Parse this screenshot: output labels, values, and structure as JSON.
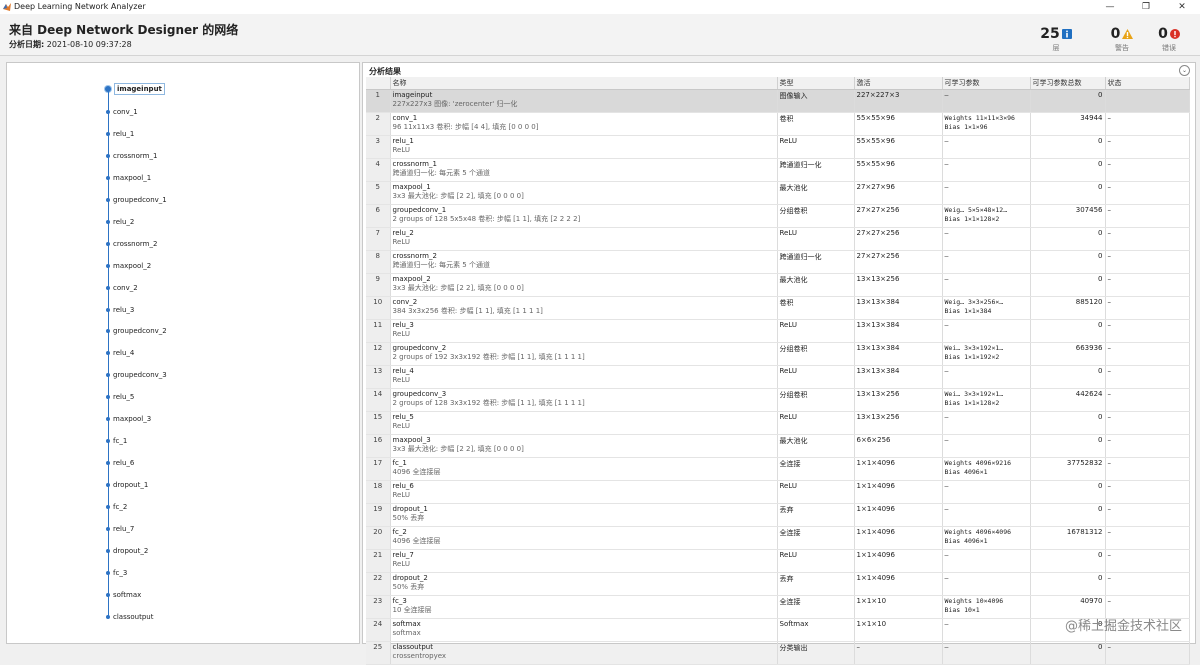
{
  "window": {
    "title": "Deep Learning Network Analyzer"
  },
  "header": {
    "title": "来自 Deep Network Designer 的网络",
    "date_label": "分析日期:",
    "date_value": "2021-08-10 09:37:28"
  },
  "stats": {
    "layers": {
      "value": "25",
      "label": "层",
      "color": "#1f6fc1"
    },
    "warnings": {
      "value": "0",
      "label": "警告",
      "color": "#e8a317"
    },
    "errors": {
      "value": "0",
      "label": "错误",
      "color": "#d93025"
    }
  },
  "results": {
    "panel_title": "分析结果",
    "columns": [
      "",
      "名称",
      "类型",
      "激活",
      "可学习参数",
      "可学习参数总数",
      "状态"
    ],
    "rows": [
      {
        "i": "1",
        "name": "imageinput",
        "desc": "227x227x3 图像: 'zerocenter' 归一化",
        "type": "图像输入",
        "act": "227×227×3",
        "p1": "–",
        "p2": "",
        "total": "0",
        "status": ""
      },
      {
        "i": "2",
        "name": "conv_1",
        "desc": "96 11x11x3 卷积: 步幅 [4 4], 填充 [0 0 0 0]",
        "type": "卷积",
        "act": "55×55×96",
        "p1": "Weights  11×11×3×96",
        "p2": "Bias     1×1×96",
        "total": "34944",
        "status": "–"
      },
      {
        "i": "3",
        "name": "relu_1",
        "desc": "ReLU",
        "type": "ReLU",
        "act": "55×55×96",
        "p1": "–",
        "p2": "",
        "total": "0",
        "status": "–"
      },
      {
        "i": "4",
        "name": "crossnorm_1",
        "desc": "跨通道归一化: 每元素 5 个通道",
        "type": "跨通道归一化",
        "act": "55×55×96",
        "p1": "–",
        "p2": "",
        "total": "0",
        "status": "–"
      },
      {
        "i": "5",
        "name": "maxpool_1",
        "desc": "3x3 最大池化: 步幅 [2 2], 填充 [0 0 0 0]",
        "type": "最大池化",
        "act": "27×27×96",
        "p1": "–",
        "p2": "",
        "total": "0",
        "status": "–"
      },
      {
        "i": "6",
        "name": "groupedconv_1",
        "desc": "2 groups of 128 5x5x48 卷积: 步幅 [1 1], 填充 [2 2 2 2]",
        "type": "分组卷积",
        "act": "27×27×256",
        "p1": "Weig…  5×5×48×12…",
        "p2": "Bias   1×1×128×2",
        "total": "307456",
        "status": "–"
      },
      {
        "i": "7",
        "name": "relu_2",
        "desc": "ReLU",
        "type": "ReLU",
        "act": "27×27×256",
        "p1": "–",
        "p2": "",
        "total": "0",
        "status": "–"
      },
      {
        "i": "8",
        "name": "crossnorm_2",
        "desc": "跨通道归一化: 每元素 5 个通道",
        "type": "跨通道归一化",
        "act": "27×27×256",
        "p1": "–",
        "p2": "",
        "total": "0",
        "status": "–"
      },
      {
        "i": "9",
        "name": "maxpool_2",
        "desc": "3x3 最大池化: 步幅 [2 2], 填充 [0 0 0 0]",
        "type": "最大池化",
        "act": "13×13×256",
        "p1": "–",
        "p2": "",
        "total": "0",
        "status": "–"
      },
      {
        "i": "10",
        "name": "conv_2",
        "desc": "384 3x3x256 卷积: 步幅 [1 1], 填充 [1 1 1 1]",
        "type": "卷积",
        "act": "13×13×384",
        "p1": "Weig…  3×3×256×…",
        "p2": "Bias   1×1×384",
        "total": "885120",
        "status": "–"
      },
      {
        "i": "11",
        "name": "relu_3",
        "desc": "ReLU",
        "type": "ReLU",
        "act": "13×13×384",
        "p1": "–",
        "p2": "",
        "total": "0",
        "status": "–"
      },
      {
        "i": "12",
        "name": "groupedconv_2",
        "desc": "2 groups of 192 3x3x192 卷积: 步幅 [1 1], 填充 [1 1 1 1]",
        "type": "分组卷积",
        "act": "13×13×384",
        "p1": "Wei…  3×3×192×1…",
        "p2": "Bias  1×1×192×2",
        "total": "663936",
        "status": "–"
      },
      {
        "i": "13",
        "name": "relu_4",
        "desc": "ReLU",
        "type": "ReLU",
        "act": "13×13×384",
        "p1": "–",
        "p2": "",
        "total": "0",
        "status": "–"
      },
      {
        "i": "14",
        "name": "groupedconv_3",
        "desc": "2 groups of 128 3x3x192 卷积: 步幅 [1 1], 填充 [1 1 1 1]",
        "type": "分组卷积",
        "act": "13×13×256",
        "p1": "Wei…  3×3×192×1…",
        "p2": "Bias  1×1×128×2",
        "total": "442624",
        "status": "–"
      },
      {
        "i": "15",
        "name": "relu_5",
        "desc": "ReLU",
        "type": "ReLU",
        "act": "13×13×256",
        "p1": "–",
        "p2": "",
        "total": "0",
        "status": "–"
      },
      {
        "i": "16",
        "name": "maxpool_3",
        "desc": "3x3 最大池化: 步幅 [2 2], 填充 [0 0 0 0]",
        "type": "最大池化",
        "act": "6×6×256",
        "p1": "–",
        "p2": "",
        "total": "0",
        "status": "–"
      },
      {
        "i": "17",
        "name": "fc_1",
        "desc": "4096 全连接层",
        "type": "全连接",
        "act": "1×1×4096",
        "p1": "Weights  4096×9216",
        "p2": "Bias     4096×1",
        "total": "37752832",
        "status": "–"
      },
      {
        "i": "18",
        "name": "relu_6",
        "desc": "ReLU",
        "type": "ReLU",
        "act": "1×1×4096",
        "p1": "–",
        "p2": "",
        "total": "0",
        "status": "–"
      },
      {
        "i": "19",
        "name": "dropout_1",
        "desc": "50% 丢弃",
        "type": "丢弃",
        "act": "1×1×4096",
        "p1": "–",
        "p2": "",
        "total": "0",
        "status": "–"
      },
      {
        "i": "20",
        "name": "fc_2",
        "desc": "4096 全连接层",
        "type": "全连接",
        "act": "1×1×4096",
        "p1": "Weights  4096×4096",
        "p2": "Bias     4096×1",
        "total": "16781312",
        "status": "–"
      },
      {
        "i": "21",
        "name": "relu_7",
        "desc": "ReLU",
        "type": "ReLU",
        "act": "1×1×4096",
        "p1": "–",
        "p2": "",
        "total": "0",
        "status": "–"
      },
      {
        "i": "22",
        "name": "dropout_2",
        "desc": "50% 丢弃",
        "type": "丢弃",
        "act": "1×1×4096",
        "p1": "–",
        "p2": "",
        "total": "0",
        "status": "–"
      },
      {
        "i": "23",
        "name": "fc_3",
        "desc": "10 全连接层",
        "type": "全连接",
        "act": "1×1×10",
        "p1": "Weights  10×4096",
        "p2": "Bias     10×1",
        "total": "40970",
        "status": "–"
      },
      {
        "i": "24",
        "name": "softmax",
        "desc": "softmax",
        "type": "Softmax",
        "act": "1×1×10",
        "p1": "–",
        "p2": "",
        "total": "0",
        "status": "–"
      },
      {
        "i": "25",
        "name": "classoutput",
        "desc": "crossentropyex",
        "type": "分类输出",
        "act": "–",
        "p1": "–",
        "p2": "",
        "total": "0",
        "status": "–"
      }
    ]
  },
  "graph": {
    "selected": "imageinput",
    "nodes": [
      "imageinput",
      "conv_1",
      "relu_1",
      "crossnorm_1",
      "maxpool_1",
      "groupedconv_1",
      "relu_2",
      "crossnorm_2",
      "maxpool_2",
      "conv_2",
      "relu_3",
      "groupedconv_2",
      "relu_4",
      "groupedconv_3",
      "relu_5",
      "maxpool_3",
      "fc_1",
      "relu_6",
      "dropout_1",
      "fc_2",
      "relu_7",
      "dropout_2",
      "fc_3",
      "softmax",
      "classoutput"
    ]
  },
  "watermark": "@稀土掘金技术社区"
}
